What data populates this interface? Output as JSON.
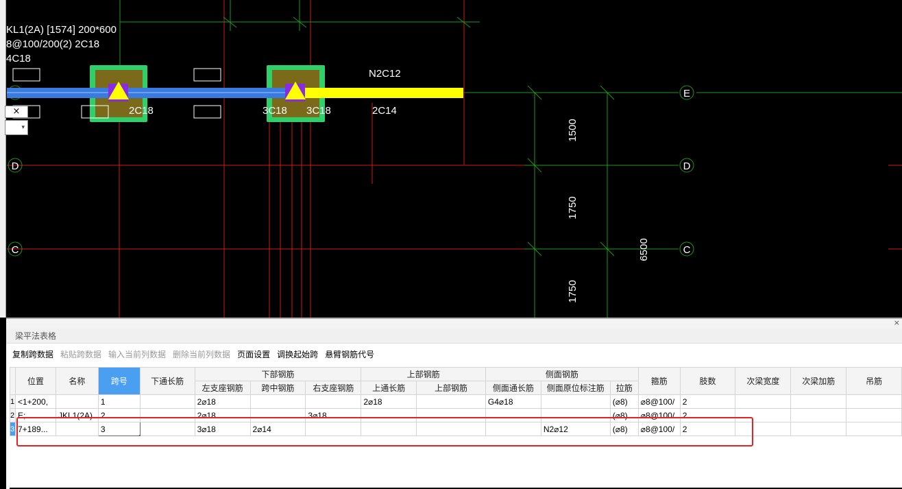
{
  "beam_label": {
    "line1": "KL1(2A) [1574] 200*600",
    "line2": "8@100/200(2) 2C18",
    "line3": "4C18"
  },
  "cad": {
    "axis_e": "E",
    "axis_d": "D",
    "axis_c": "C",
    "span_labels": {
      "n2c12": "N2C12",
      "c2c18": "2C18",
      "c3c18_a": "3C18",
      "c3c18_b": "3C18",
      "c2c14": "2C14"
    },
    "dims": {
      "d1500": "1500",
      "d1750a": "1750",
      "d1750b": "1750",
      "d6500": "6500"
    },
    "colors": {
      "grid_red": "#d11a1a",
      "grid_green": "#1c9a1c",
      "beam_blue": "#3a7be0",
      "beam_yellow": "#ffff00",
      "column_green": "#2fd06a",
      "column_fill": "#7a6a1a"
    }
  },
  "float_controls": {
    "close_glyph": "×",
    "dropdown_glyph": "▾"
  },
  "panel": {
    "close_glyph": "×",
    "title": "梁平法表格",
    "toolbar": [
      {
        "label": "复制跨数据",
        "enabled": true
      },
      {
        "label": "粘贴跨数据",
        "enabled": false
      },
      {
        "label": "输入当前列数据",
        "enabled": false
      },
      {
        "label": "删除当前列数据",
        "enabled": false
      },
      {
        "label": "页面设置",
        "enabled": true
      },
      {
        "label": "调换起始跨",
        "enabled": true
      },
      {
        "label": "悬臂钢筋代号",
        "enabled": true
      }
    ],
    "headers": {
      "position": "位置",
      "name": "名称",
      "span": "跨号",
      "bottom_long": "下通长筋",
      "group_bottom": "下部钢筋",
      "left_seat": "左支座钢筋",
      "mid_span": "跨中钢筋",
      "right_seat": "右支座钢筋",
      "group_top": "上部钢筋",
      "top_long": "上通长筋",
      "top_rebar": "上部钢筋",
      "group_side": "侧面钢筋",
      "side_long": "侧面通长筋",
      "side_orig": "侧面原位标注筋",
      "tie": "拉筋",
      "stirrup": "箍筋",
      "legs": "肢数",
      "sec_width": "次梁宽度",
      "sec_add": "次梁加筋",
      "hanger": "吊筋"
    },
    "rows": [
      {
        "num": "1",
        "position": "<1+200,",
        "name": "",
        "span": "1",
        "bottom_long": "",
        "left_seat": "2⌀18",
        "mid_span": "",
        "right_seat": "",
        "top_long": "2⌀18",
        "top_rebar": "",
        "side_long": "G4⌀18",
        "side_orig": "",
        "tie": "(⌀8)",
        "stirrup": "⌀8@100/",
        "legs": "2",
        "sec_width": "",
        "sec_add": "",
        "hanger": ""
      },
      {
        "num": "2",
        "position": "E;",
        "name": "JKL1(2A)",
        "span": "2",
        "bottom_long": "",
        "left_seat": "2⌀18",
        "mid_span": "",
        "right_seat": "3⌀18",
        "top_long": "",
        "top_rebar": "",
        "side_long": "",
        "side_orig": "",
        "tie": "(⌀8)",
        "stirrup": "⌀8@100/",
        "legs": "2",
        "sec_width": "",
        "sec_add": "",
        "hanger": ""
      },
      {
        "num": "3",
        "position": "7+189...",
        "name": "",
        "span": "3",
        "bottom_long": "",
        "left_seat": "3⌀18",
        "mid_span": "2⌀14",
        "right_seat": "",
        "top_long": "",
        "top_rebar": "",
        "side_long": "",
        "side_orig": "N2⌀12",
        "tie": "(⌀8)",
        "stirrup": "⌀8@100/",
        "legs": "2",
        "sec_width": "",
        "sec_add": "",
        "hanger": ""
      }
    ]
  }
}
